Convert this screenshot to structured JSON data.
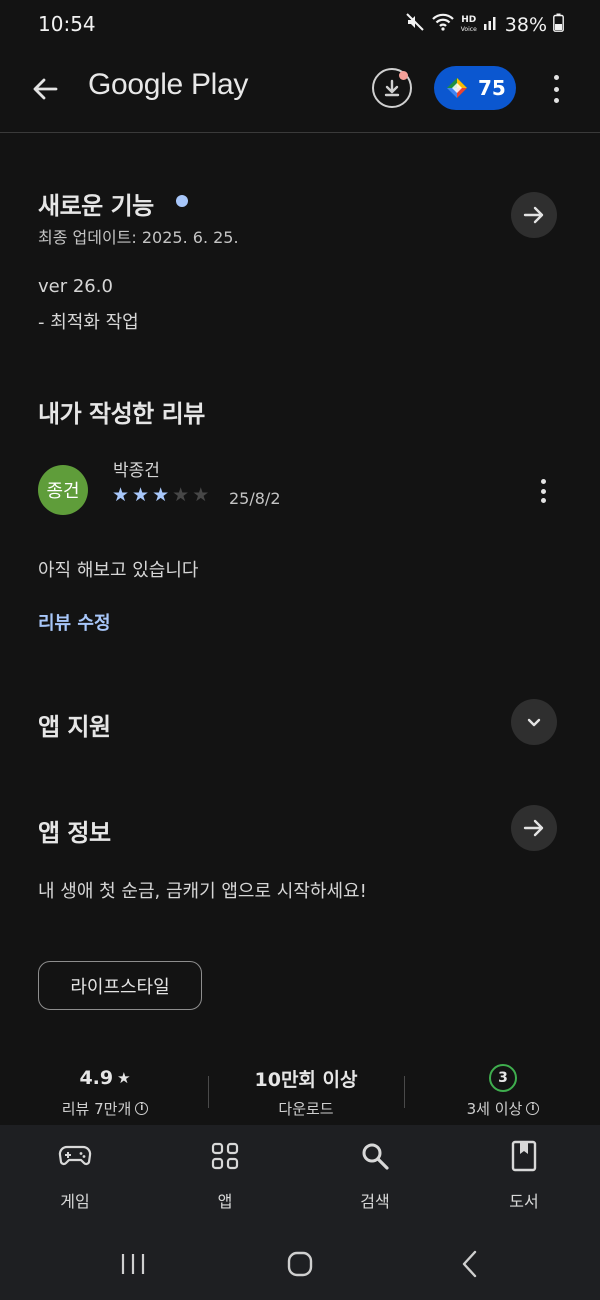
{
  "status_bar": {
    "time": "10:54",
    "hd_label": "HD",
    "voice_label": "Voice",
    "battery": "38%"
  },
  "app_bar": {
    "title": "Google Play",
    "points": "75"
  },
  "whats_new": {
    "title": "새로운 기능",
    "updated": "최종 업데이트: 2025. 6. 25.",
    "version": "ver 26.0",
    "note": "- 최적화 작업"
  },
  "my_review": {
    "title": "내가 작성한 리뷰",
    "avatar_text": "종건",
    "reviewer": "박종건",
    "rating": 3,
    "rating_max": 5,
    "date": "25/8/2",
    "text": "아직 해보고 있습니다",
    "edit_label": "리뷰 수정"
  },
  "app_support": {
    "title": "앱 지원"
  },
  "app_info": {
    "title": "앱 정보",
    "description": "내 생애 첫 순금, 금캐기 앱으로 시작하세요!",
    "category": "라이프스타일"
  },
  "stats": {
    "rating": "4.9",
    "reviews_label": "리뷰 7만개",
    "downloads": "10만회 이상",
    "downloads_label": "다운로드",
    "age_badge": "3",
    "age_label": "3세 이상"
  },
  "bottom_nav": {
    "games": "게임",
    "apps": "앱",
    "search": "검색",
    "books": "도서"
  },
  "colors": {
    "background": "#131313",
    "accent": "#a8c7fa",
    "points_pill": "#0b57d0",
    "avatar": "#5f9d3a",
    "age_badge": "#3fae4e"
  }
}
